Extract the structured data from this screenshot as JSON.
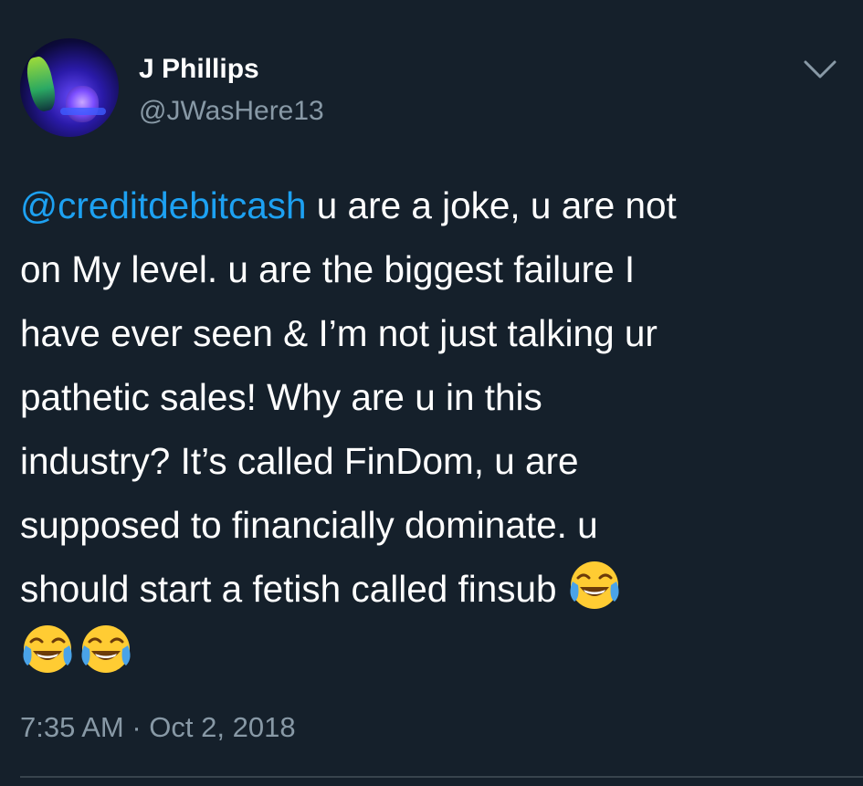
{
  "author": {
    "display_name": "J Phillips",
    "handle": "@JWasHere13"
  },
  "tweet": {
    "mention": "@creditdebitcash",
    "line1_rest": " u are a joke, u are not",
    "line2": "on My level. u are the biggest failure I",
    "line3": "have ever seen & I’m not just talking ur",
    "line4": "pathetic sales! Why are u in this",
    "line5": "industry? It’s called FinDom, u are",
    "line6": "supposed to financially dominate. u",
    "line7": "should start a fetish called finsub ",
    "emoji_name": "face-with-tears-of-joy-icon"
  },
  "meta": {
    "timestamp": "7:35 AM · Oct 2, 2018"
  },
  "colors": {
    "background": "#15202b",
    "mention": "#1da1f2",
    "secondary_text": "#8899a6",
    "divider": "#38444d"
  }
}
